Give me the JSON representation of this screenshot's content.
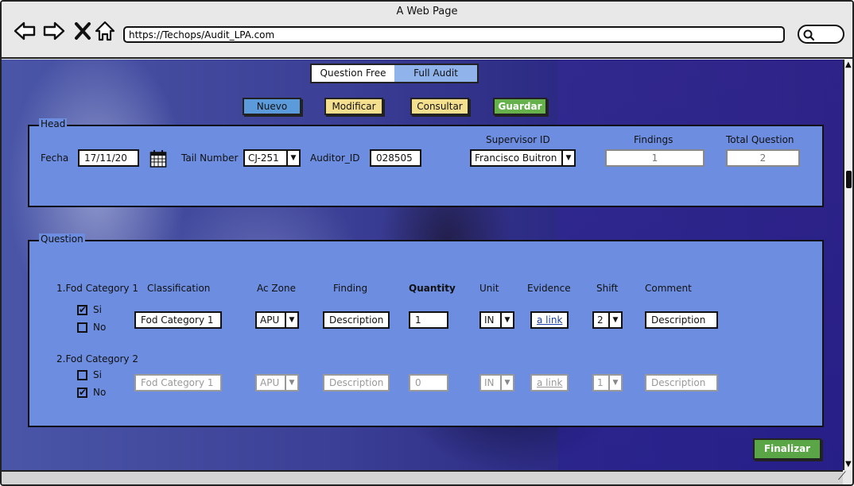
{
  "window": {
    "title": "A Web Page",
    "url": "https://Techops/Audit_LPA.com"
  },
  "tabs": {
    "question_free": "Question Free",
    "full_audit": "Full Audit"
  },
  "actions": {
    "nuevo": "Nuevo",
    "modificar": "Modificar",
    "consultar": "Consultar",
    "guardar": "Guardar",
    "finalizar": "Finalizar"
  },
  "head": {
    "legend": "Head",
    "fecha_label": "Fecha",
    "fecha_value": "17/11/20",
    "tail_label": "Tail Number",
    "tail_value": "CJ-251",
    "auditor_label": "Auditor_ID",
    "auditor_value": "028505",
    "supervisor_label": "Supervisor ID",
    "supervisor_value": "Francisco Buitron",
    "findings_label": "Findings",
    "findings_value": "1",
    "total_label": "Total Question",
    "total_value": "2"
  },
  "question": {
    "legend": "Question",
    "headers": {
      "classification": "Classification",
      "ac_zone": "Ac Zone",
      "finding": "Finding",
      "quantity": "Quantity",
      "unit": "Unit",
      "evidence": "Evidence",
      "shift": "Shift",
      "comment": "Comment"
    },
    "rows": [
      {
        "title": "1.Fod Category 1",
        "si": "Si",
        "no": "No",
        "si_checked": true,
        "no_checked": false,
        "classification": "Fod Category 1",
        "ac_zone": "APU",
        "finding": "Description",
        "quantity": "1",
        "unit": "IN",
        "evidence": "a link",
        "shift": "2",
        "comment": "Description"
      },
      {
        "title": "2.Fod Category 2",
        "si": "Si",
        "no": "No",
        "si_checked": false,
        "no_checked": true,
        "classification": "Fod Category 1",
        "ac_zone": "APU",
        "finding": "Description",
        "quantity": "0",
        "unit": "IN",
        "evidence": "a link",
        "shift": "1",
        "comment": "Description"
      }
    ]
  },
  "glyphs": {
    "check": "✔",
    "caret": "▼",
    "up_arrow": "▲",
    "down_arrow": "▼",
    "grip": "⟋"
  },
  "icons": {
    "back": "back-arrow-icon",
    "forward": "forward-arrow-icon",
    "close": "close-icon",
    "home": "home-icon",
    "search": "search-icon",
    "calendar": "calendar-icon"
  }
}
